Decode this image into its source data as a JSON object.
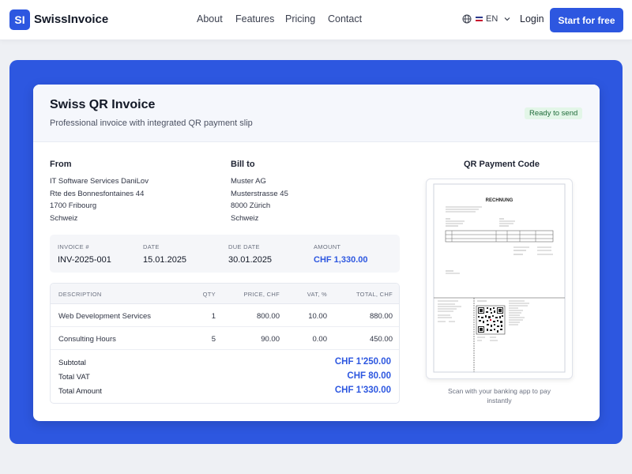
{
  "nav": {
    "logo_initials": "SI",
    "brand": "SwissInvoice",
    "links": [
      "About",
      "Features",
      "Pricing",
      "Contact"
    ],
    "language": "EN",
    "login": "Login",
    "cta": "Start for free"
  },
  "invoice": {
    "title": "Swiss QR Invoice",
    "subtitle": "Professional invoice with integrated QR payment slip",
    "status_badge": "Ready to send",
    "from": {
      "label": "From",
      "lines": [
        "IT Software Services DaniLov",
        "Rte des Bonnesfontaines 44",
        "1700 Fribourg",
        "Schweiz"
      ]
    },
    "bill_to": {
      "label": "Bill to",
      "lines": [
        "Muster AG",
        "Musterstrasse 45",
        "8000 Zürich",
        "Schweiz"
      ]
    },
    "meta": {
      "invoice_no_label": "INVOICE #",
      "invoice_no": "INV-2025-001",
      "date_label": "DATE",
      "date": "15.01.2025",
      "due_label": "DUE DATE",
      "due": "30.01.2025",
      "amount_label": "AMOUNT",
      "amount": "CHF 1,330.00"
    },
    "table": {
      "headers": [
        "DESCRIPTION",
        "QTY",
        "PRICE, CHF",
        "VAT, %",
        "TOTAL, CHF"
      ],
      "rows": [
        [
          "Web Development Services",
          "1",
          "800.00",
          "10.00",
          "880.00"
        ],
        [
          "Consulting Hours",
          "5",
          "90.00",
          "0.00",
          "450.00"
        ]
      ],
      "subtotal_label": "Subtotal",
      "subtotal": "CHF 1'250.00",
      "vat_label": "Total VAT",
      "vat": "CHF 80.00",
      "total_label": "Total Amount",
      "total": "CHF 1'330.00"
    },
    "qr": {
      "title": "QR Payment Code",
      "preview_heading": "RECHNUNG",
      "caption": "Scan with your banking app to pay instantly"
    }
  },
  "colors": {
    "accent": "#2d57e0",
    "badge_bg": "#e3f6e8",
    "badge_text": "#1f6b3a"
  },
  "icons": {
    "language": "globe-icon",
    "dropdown": "chevron-down-icon"
  }
}
